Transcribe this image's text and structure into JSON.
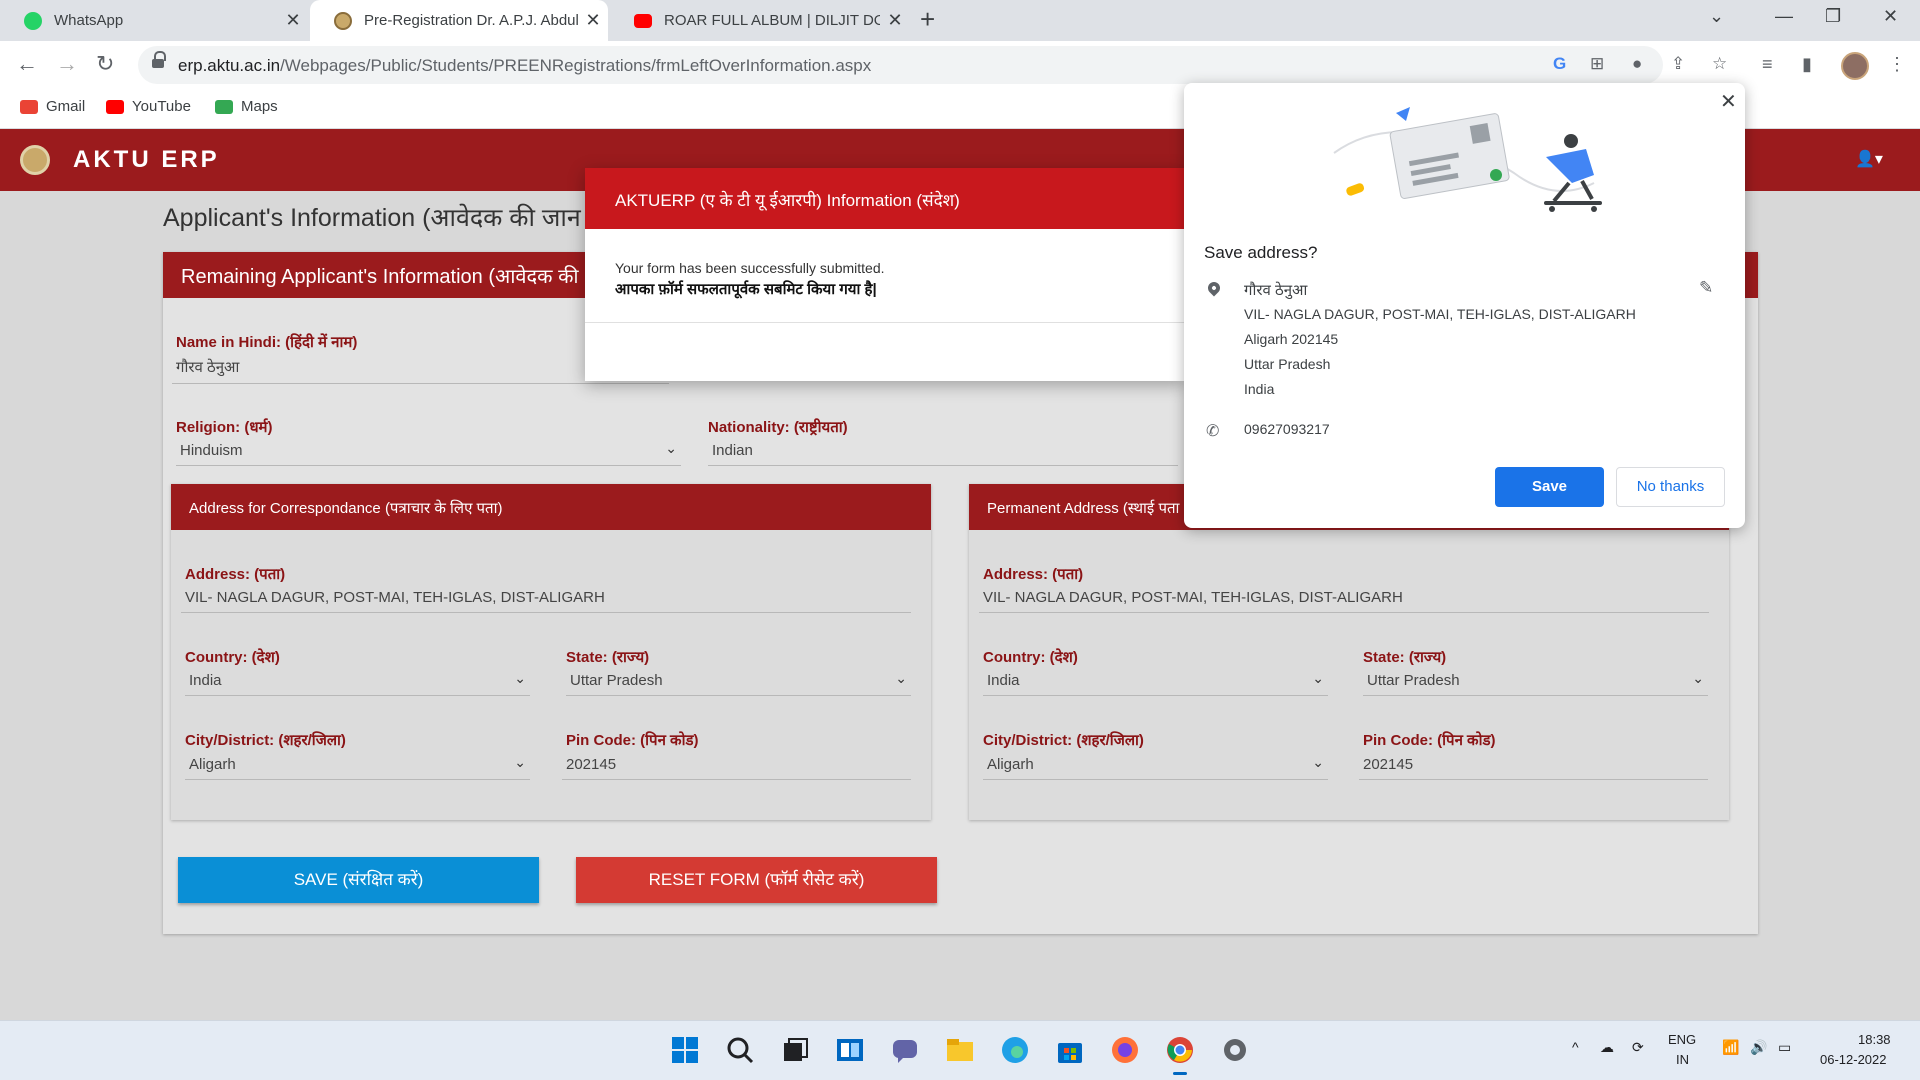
{
  "browser": {
    "tabs": [
      {
        "title": "WhatsApp",
        "active": false
      },
      {
        "title": "Pre-Registration Dr. A.P.J. Abdul",
        "active": true
      },
      {
        "title": "ROAR FULL ALBUM | DILJIT DOS",
        "active": false
      }
    ],
    "url_domain": "erp.aktu.ac.in",
    "url_path": "/Webpages/Public/Students/PREENRegistrations/frmLeftOverInformation.aspx",
    "bookmarks": [
      "Gmail",
      "YouTube",
      "Maps"
    ]
  },
  "app": {
    "title": "AKTU ERP",
    "page_heading": "Applicant's Information (आवेदक की जान",
    "card_title": "Remaining Applicant's Information (आवेदक की",
    "fields": {
      "name_hindi_label": "Name in Hindi: (हिंदी में नाम)",
      "name_hindi_value": "गौरव ठेनुआ",
      "religion_label": "Religion: (धर्म)",
      "religion_value": "Hinduism",
      "nationality_label": "Nationality: (राष्ट्रीयता)",
      "nationality_value": "Indian"
    },
    "correspondence": {
      "title": "Address for Correspondance (पत्राचार के लिए पता)",
      "address_label": "Address: (पता)",
      "address_value": "VIL- NAGLA DAGUR, POST-MAI, TEH-IGLAS, DIST-ALIGARH",
      "country_label": "Country: (देश)",
      "country_value": "India",
      "state_label": "State: (राज्य)",
      "state_value": "Uttar Pradesh",
      "city_label": "City/District: (शहर/जिला)",
      "city_value": "Aligarh",
      "pin_label": "Pin Code: (पिन कोड)",
      "pin_value": "202145"
    },
    "permanent": {
      "title": "Permanent Address (स्थाई पता",
      "address_label": "Address: (पता)",
      "address_value": "VIL- NAGLA DAGUR, POST-MAI, TEH-IGLAS, DIST-ALIGARH",
      "country_label": "Country: (देश)",
      "country_value": "India",
      "state_label": "State: (राज्य)",
      "state_value": "Uttar Pradesh",
      "city_label": "City/District: (शहर/जिला)",
      "city_value": "Aligarh",
      "pin_label": "Pin Code: (पिन कोड)",
      "pin_value": "202145"
    },
    "save_button": "SAVE (संरक्षित करें)",
    "reset_button": "RESET FORM (फॉर्म रीसेट करें)"
  },
  "modal": {
    "title": "AKTUERP (ए के टी यू ईआरपी) Information (संदेश)",
    "line1": "Your form has been successfully submitted.",
    "line2": "आपका फ़ॉर्म सफलतापूर्वक सबमिट किया गया है|"
  },
  "address_popup": {
    "title": "Save address?",
    "name": "गौरव ठेनुआ",
    "line1": "VIL- NAGLA DAGUR, POST-MAI, TEH-IGLAS, DIST-ALIGARH",
    "line2": "Aligarh 202145",
    "line3": "Uttar Pradesh",
    "line4": "India",
    "phone": "09627093217",
    "save_label": "Save",
    "no_thanks_label": "No thanks"
  },
  "taskbar": {
    "lang_line1": "ENG",
    "lang_line2": "IN",
    "time": "18:38",
    "date": "06-12-2022"
  },
  "colors": {
    "brand_red": "#9b1b1d",
    "modal_red": "#c8181d",
    "save_blue": "#0a8fd6",
    "reset_red": "#d43a33",
    "chrome_blue": "#1a73e8"
  }
}
